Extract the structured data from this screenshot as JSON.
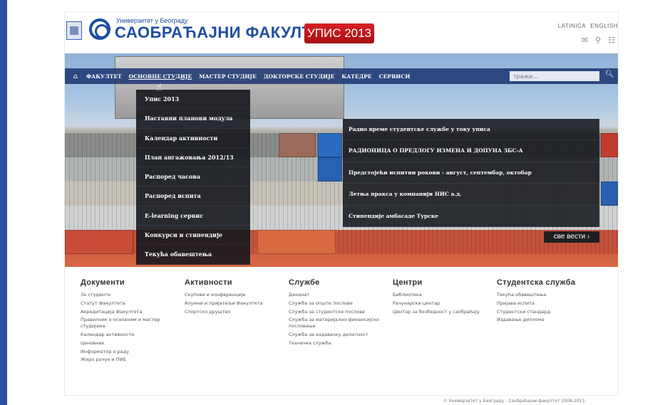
{
  "header": {
    "university": "Универзитет у Београду",
    "faculty": "САОБРАЋАЈНИ ФАКУЛТЕТ",
    "upis_badge": "УПИС 2013",
    "lang_latin": "LATINICA",
    "lang_english": "ENGLISH"
  },
  "nav": {
    "items": [
      "ФАКУЛТЕТ",
      "ОСНОВНЕ СТУДИЈЕ",
      "МАСТЕР СТУДИЈЕ",
      "ДОКТОРСКЕ СТУДИЈЕ",
      "КАТЕДРЕ",
      "СЕРВИСИ"
    ],
    "search_placeholder": "тражи..."
  },
  "dropdown": {
    "items": [
      "Упис 2013",
      "Наставни планови модула",
      "Календар активности",
      "План ангажовања 2012/13",
      "Распоред часова",
      "Распоред испита",
      "E-learning сервис",
      "Конкурси и стипендије",
      "Текућа обавештења"
    ]
  },
  "news": {
    "items": [
      "Радно време студентске службе у току уписа",
      "РАДИОНИЦА О ПРЕДЛОГУ ИЗМЕНА И ДОПУНА ЗБС-А",
      "Предстојећи испитни рокови - август, септембар, октобар",
      "Летња пракса у компанији НИС а.д.",
      "Стипендије амбасаде Турске"
    ],
    "all_news": "све вести"
  },
  "columns": [
    {
      "title": "Документи",
      "links": [
        "За студенте",
        "Статут Факултета",
        "Акредитација Факултета",
        "Правилник о основним и мастер студијама",
        "Календар активности",
        "Ценовник",
        "Информатор о раду",
        "Жиро рачун и ПИБ"
      ]
    },
    {
      "title": "Активности",
      "links": [
        "Скупови и конференције",
        "Алумни и пријатељи Факултета",
        "Спортско друштво"
      ]
    },
    {
      "title": "Службе",
      "links": [
        "Деканат",
        "Служба за опште послове",
        "Служба за студентске послове",
        "Служба за материјално-финансијско пословање",
        "Служба за издавачку делатност",
        "Техничка служба"
      ]
    },
    {
      "title": "Центри",
      "links": [
        "Библиотека",
        "Рачунарски центар",
        "Центар за безбедност у саобраћају"
      ]
    },
    {
      "title": "Студентска служба",
      "links": [
        "Текућа обавештења",
        "Пријава испита",
        "Студентски стандард",
        "Издавање диплома"
      ]
    }
  ],
  "footer": {
    "copyright": "© Универзитет у Београду - Саобраћајни факултет 2008-2013"
  }
}
